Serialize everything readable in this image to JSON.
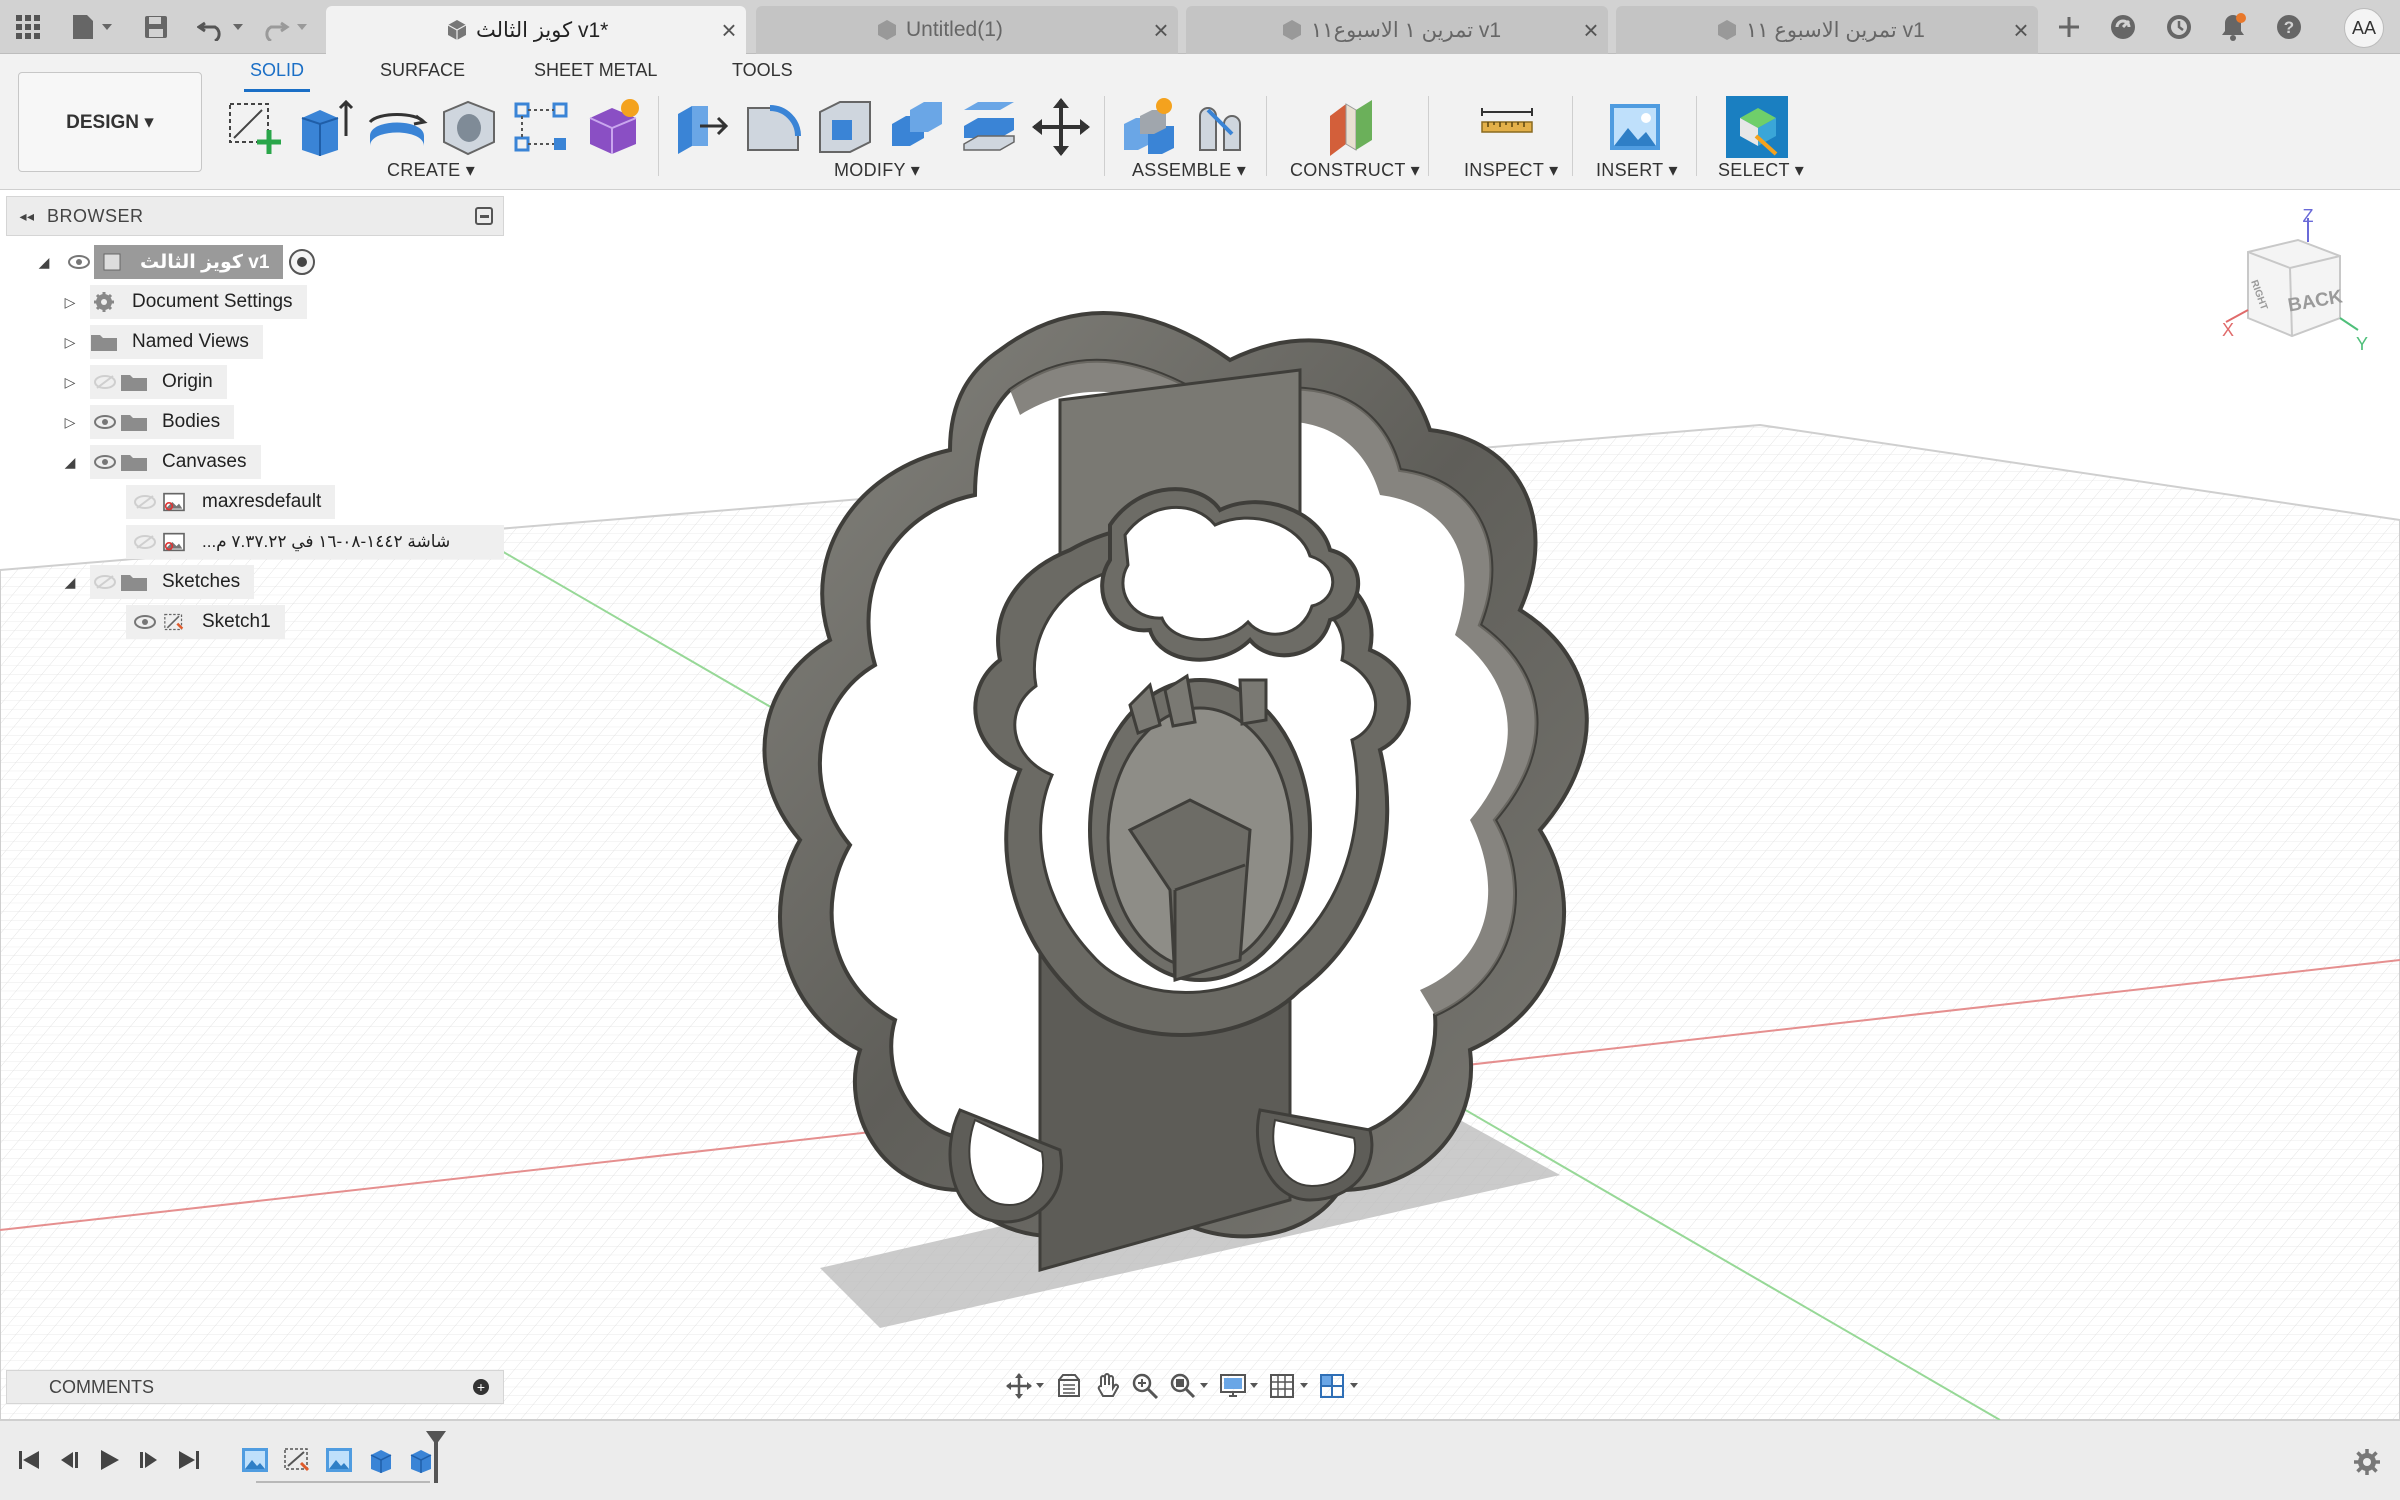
{
  "tabs": [
    {
      "title": "كويز الثالث v1*",
      "active": true
    },
    {
      "title": "Untitled(1)",
      "active": false
    },
    {
      "title": "تمرين ١ الاسبوع١١ v1",
      "active": false
    },
    {
      "title": "تمرين الاسبوع ١١ v1",
      "active": false
    }
  ],
  "user_initials": "AA",
  "workspace_tabs": [
    "SOLID",
    "SURFACE",
    "SHEET METAL",
    "TOOLS"
  ],
  "design_button": "DESIGN ▾",
  "tool_groups": [
    "CREATE ▾",
    "MODIFY ▾",
    "ASSEMBLE ▾",
    "CONSTRUCT ▾",
    "INSPECT ▾",
    "INSERT ▾",
    "SELECT ▾"
  ],
  "browser": {
    "title": "BROWSER",
    "root": "كويز الثالث v1",
    "items": [
      {
        "label": "Document Settings"
      },
      {
        "label": "Named Views"
      },
      {
        "label": "Origin"
      },
      {
        "label": "Bodies"
      },
      {
        "label": "Canvases"
      },
      {
        "label": "maxresdefault"
      },
      {
        "label": "...شاشة ١٤٤٢-٠٨-١٦ في ٧.٣٧.٢٢ م"
      },
      {
        "label": "Sketches"
      },
      {
        "label": "Sketch1"
      }
    ]
  },
  "comments": {
    "title": "COMMENTS"
  },
  "viewcube": {
    "face": "BACK",
    "side": "RIGHT",
    "axes": [
      "Z",
      "X",
      "Y"
    ]
  },
  "icons": [
    "grid-menu-icon",
    "file-icon",
    "save-icon",
    "undo-icon",
    "redo-icon",
    "new-tab-icon",
    "extensions-icon",
    "job-status-icon",
    "notifications-icon",
    "help-icon",
    "eye-icon",
    "gear-icon",
    "folder-icon",
    "canvas-icon",
    "sketch-icon"
  ],
  "colors": {
    "accent": "#1b6fc6",
    "model": "#6e6d68",
    "axis_red": "#e06b6b",
    "axis_green": "#7ccf7c"
  }
}
